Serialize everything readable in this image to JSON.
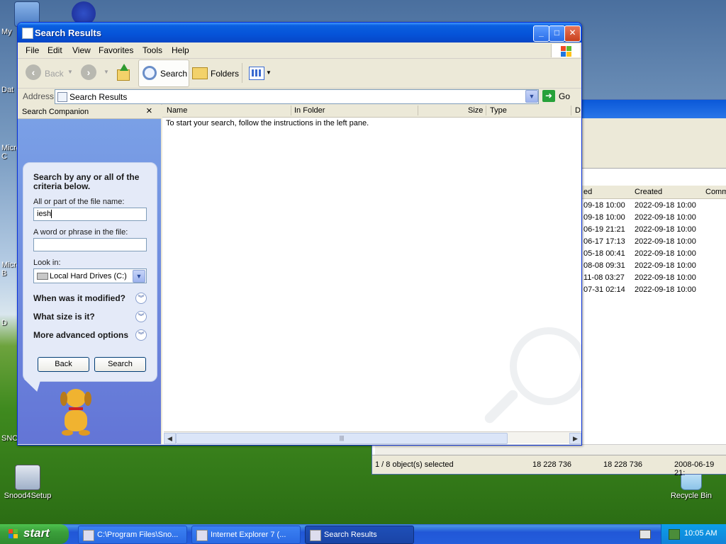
{
  "desktop": {
    "icons": [
      {
        "label": "My"
      },
      {
        "label": "Dat"
      },
      {
        "label": "Micro\nC"
      },
      {
        "label": "Micro\nB"
      },
      {
        "label": "D"
      },
      {
        "label": "SNO"
      },
      {
        "label": "Snood4Setup"
      },
      {
        "label": "Recycle Bin"
      }
    ]
  },
  "bg_window": {
    "columns": [
      "ed",
      "Created",
      "Comm"
    ],
    "rows": [
      {
        "modified": "09-18 10:00",
        "created": "2022-09-18 10:00"
      },
      {
        "modified": "09-18 10:00",
        "created": "2022-09-18 10:00"
      },
      {
        "modified": "06-19 21:21",
        "created": "2022-09-18 10:00"
      },
      {
        "modified": "06-17 17:13",
        "created": "2022-09-18 10:00"
      },
      {
        "modified": "05-18 00:41",
        "created": "2022-09-18 10:00"
      },
      {
        "modified": "08-08 09:31",
        "created": "2022-09-18 10:00"
      },
      {
        "modified": "11-08 03:27",
        "created": "2022-09-18 10:00"
      },
      {
        "modified": "07-31 02:14",
        "created": "2022-09-18 10:00"
      }
    ],
    "status": {
      "selected": "1 / 8 object(s) selected",
      "size1": "18 228 736",
      "size2": "18 228 736",
      "date": "2008-06-19 21:"
    }
  },
  "window": {
    "title": "Search Results",
    "menu": [
      "File",
      "Edit",
      "View",
      "Favorites",
      "Tools",
      "Help"
    ],
    "toolbar": {
      "back": "Back",
      "search": "Search",
      "folders": "Folders"
    },
    "address": {
      "label": "Address",
      "value": "Search Results",
      "go": "Go"
    },
    "companion": {
      "title": "Search Companion",
      "heading": "Search by any or all of the criteria below.",
      "filename_label": "All or part of the file name:",
      "filename_value": "iesh",
      "phrase_label": "A word or phrase in the file:",
      "phrase_value": "",
      "lookin_label": "Look in:",
      "lookin_value": "Local Hard Drives (C:)",
      "expanders": [
        "When was it modified?",
        "What size is it?",
        "More advanced options"
      ],
      "back_button": "Back",
      "search_button": "Search"
    },
    "results": {
      "columns": [
        "Name",
        "In Folder",
        "Size",
        "Type",
        "D"
      ],
      "message": "To start your search, follow the instructions in the left pane."
    }
  },
  "taskbar": {
    "start": "start",
    "tasks": [
      "C:\\Program Files\\Sno...",
      "Internet Explorer 7 (...",
      "Search Results"
    ],
    "clock": "10:05 AM"
  },
  "colors": {
    "xp_blue": "#0553d8",
    "start_green": "#3b9f3b",
    "pane_blue": "#6f8ade"
  }
}
